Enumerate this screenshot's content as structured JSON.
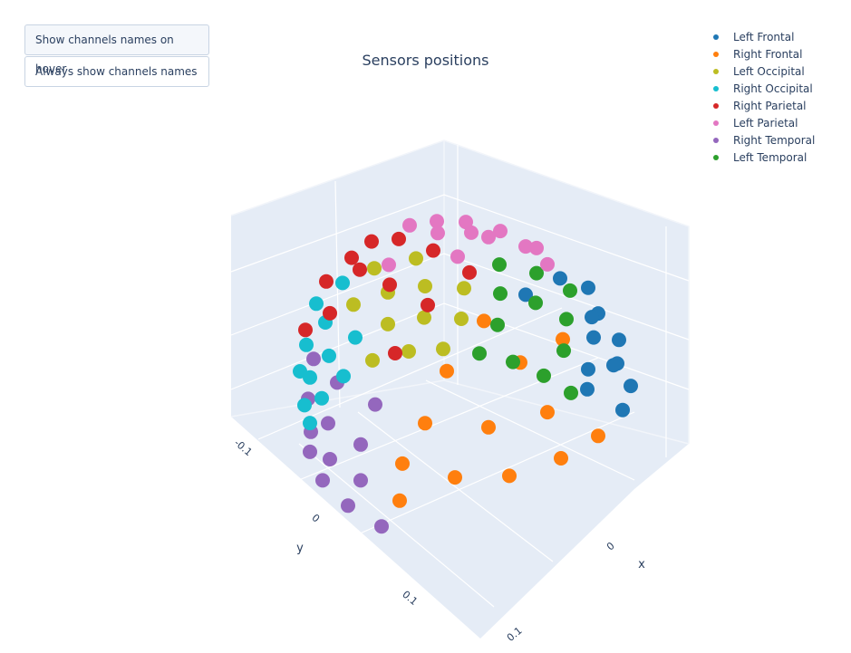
{
  "buttons": [
    {
      "label": "Show channels names on hover",
      "active": true
    },
    {
      "label": "Always show channels names",
      "active": false
    }
  ],
  "chart_data": {
    "type": "scatter3d",
    "title": "Sensors positions",
    "xlabel": "x",
    "ylabel": "y",
    "zlabel": "",
    "x_ticks": [
      "0",
      "0.1"
    ],
    "y_ticks": [
      "-0.1",
      "0",
      "0.1"
    ],
    "z_ticks": [],
    "legend_position": "top-right",
    "background": "#e5ecf6",
    "grid": true,
    "series": [
      {
        "name": "Left Frontal",
        "color": "#1f77b4",
        "points": [
          [
            -0.165,
            -0.052,
            0.05
          ],
          [
            -0.169,
            -0.025,
            0.05
          ],
          [
            -0.126,
            -0.051,
            0.05
          ],
          [
            -0.143,
            0.012,
            0.05
          ],
          [
            -0.135,
            0.013,
            0.05
          ],
          [
            -0.111,
            0.039,
            0.05
          ],
          [
            -0.122,
            0.056,
            0.05
          ],
          [
            -0.069,
            0.075,
            0.05
          ],
          [
            -0.088,
            0.084,
            0.05
          ],
          [
            -0.092,
            0.084,
            0.05
          ],
          [
            -0.072,
            0.119,
            0.05
          ],
          [
            -0.044,
            0.099,
            0.05
          ],
          [
            -0.038,
            0.144,
            0.05
          ]
        ]
      },
      {
        "name": "Right Frontal",
        "color": "#ff7f0e",
        "points": [
          [
            -0.143,
            -0.114,
            0.0
          ],
          [
            -0.164,
            -0.048,
            0.0
          ],
          [
            -0.112,
            -0.043,
            0.0
          ],
          [
            -0.061,
            -0.073,
            0.0
          ],
          [
            0.015,
            -0.021,
            0.0
          ],
          [
            -0.015,
            0.019,
            0.0
          ],
          [
            -0.066,
            0.033,
            0.0
          ],
          [
            0.077,
            0.016,
            0.0
          ],
          [
            0.065,
            0.062,
            0.0
          ],
          [
            0.033,
            0.09,
            0.0
          ],
          [
            -0.017,
            0.097,
            0.0
          ],
          [
            -0.065,
            0.09,
            0.0
          ],
          [
            0.124,
            0.06,
            0.0
          ]
        ]
      },
      {
        "name": "Left Occipital",
        "color": "#bcbd22",
        "points": [
          [
            -0.046,
            -0.138,
            0.07
          ],
          [
            -0.081,
            -0.127,
            0.07
          ],
          [
            -0.024,
            -0.101,
            0.07
          ],
          [
            -0.052,
            -0.088,
            0.07
          ],
          [
            -0.071,
            -0.064,
            0.07
          ],
          [
            0.01,
            -0.105,
            0.07
          ],
          [
            0.015,
            -0.062,
            0.07
          ],
          [
            -0.013,
            -0.05,
            0.07
          ],
          [
            -0.032,
            -0.028,
            0.07
          ],
          [
            0.015,
            -0.001,
            0.07
          ],
          [
            0.037,
            -0.017,
            0.07
          ],
          [
            0.068,
            -0.026,
            0.07
          ]
        ]
      },
      {
        "name": "Right Occipital",
        "color": "#17becf",
        "points": [
          [
            -0.025,
            -0.152,
            0.06
          ],
          [
            0.015,
            -0.141,
            0.06
          ],
          [
            0.033,
            -0.113,
            0.06
          ],
          [
            0.035,
            -0.078,
            0.06
          ],
          [
            0.071,
            -0.096,
            0.06
          ],
          [
            0.072,
            -0.07,
            0.06
          ],
          [
            0.107,
            -0.067,
            0.06
          ],
          [
            0.109,
            -0.054,
            0.06
          ],
          [
            0.089,
            -0.037,
            0.06
          ],
          [
            0.128,
            -0.022,
            0.06
          ],
          [
            0.146,
            -0.023,
            0.06
          ],
          [
            0.165,
            0.002,
            0.06
          ]
        ]
      },
      {
        "name": "Right Parietal",
        "color": "#d62728",
        "points": [
          [
            -0.034,
            -0.129,
            0.1
          ],
          [
            -0.052,
            -0.117,
            0.1
          ],
          [
            -0.057,
            -0.084,
            0.1
          ],
          [
            -0.003,
            -0.12,
            0.1
          ],
          [
            0.007,
            -0.101,
            0.1
          ],
          [
            0.009,
            -0.066,
            0.1
          ],
          [
            -0.05,
            -0.037,
            0.1
          ],
          [
            0.04,
            -0.105,
            0.1
          ],
          [
            0.013,
            -0.02,
            0.1
          ],
          [
            0.077,
            -0.064,
            0.1
          ],
          [
            0.111,
            -0.057,
            0.1
          ],
          [
            0.09,
            0.021,
            0.1
          ]
        ]
      },
      {
        "name": "Left Parietal",
        "color": "#e377c2",
        "points": [
          [
            -0.046,
            -0.099,
            0.12
          ],
          [
            -0.066,
            -0.089,
            0.12
          ],
          [
            -0.052,
            -0.074,
            0.12
          ],
          [
            -0.081,
            -0.072,
            0.12
          ],
          [
            -0.071,
            -0.056,
            0.12
          ],
          [
            -0.075,
            -0.041,
            0.12
          ],
          [
            -0.089,
            -0.042,
            0.12
          ],
          [
            -0.034,
            -0.034,
            0.12
          ],
          [
            -0.084,
            -0.009,
            0.12
          ],
          [
            -0.088,
            -0.001,
            0.12
          ],
          [
            0.014,
            -0.062,
            0.12
          ],
          [
            -0.074,
            0.025,
            0.12
          ]
        ]
      },
      {
        "name": "Right Temporal",
        "color": "#9467bd",
        "points": [
          [
            0.012,
            -0.147,
            0.01
          ],
          [
            0.028,
            -0.105,
            0.01
          ],
          [
            0.064,
            -0.101,
            0.01
          ],
          [
            0.034,
            -0.057,
            0.01
          ],
          [
            0.083,
            -0.06,
            0.01
          ],
          [
            0.103,
            -0.059,
            0.01
          ],
          [
            0.091,
            -0.016,
            0.01
          ],
          [
            0.128,
            -0.035,
            0.01
          ],
          [
            0.126,
            -0.015,
            0.01
          ],
          [
            0.156,
            0.007,
            0.01
          ],
          [
            0.135,
            0.028,
            0.01
          ],
          [
            0.173,
            0.052,
            0.01
          ],
          [
            0.18,
            0.096,
            0.01
          ]
        ]
      },
      {
        "name": "Left Temporal",
        "color": "#2ca02c",
        "points": [
          [
            -0.134,
            -0.088,
            0.06
          ],
          [
            -0.144,
            -0.057,
            0.06
          ],
          [
            -0.141,
            -0.017,
            0.06
          ],
          [
            -0.099,
            -0.052,
            0.06
          ],
          [
            -0.107,
            -0.021,
            0.06
          ],
          [
            -0.059,
            -0.015,
            0.06
          ],
          [
            -0.104,
            0.016,
            0.06
          ],
          [
            -0.064,
            0.053,
            0.06
          ],
          [
            -0.014,
            0.01,
            0.06
          ],
          [
            -0.022,
            0.039,
            0.06
          ],
          [
            -0.022,
            0.073,
            0.06
          ],
          [
            -0.016,
            0.109,
            0.06
          ]
        ]
      }
    ]
  }
}
